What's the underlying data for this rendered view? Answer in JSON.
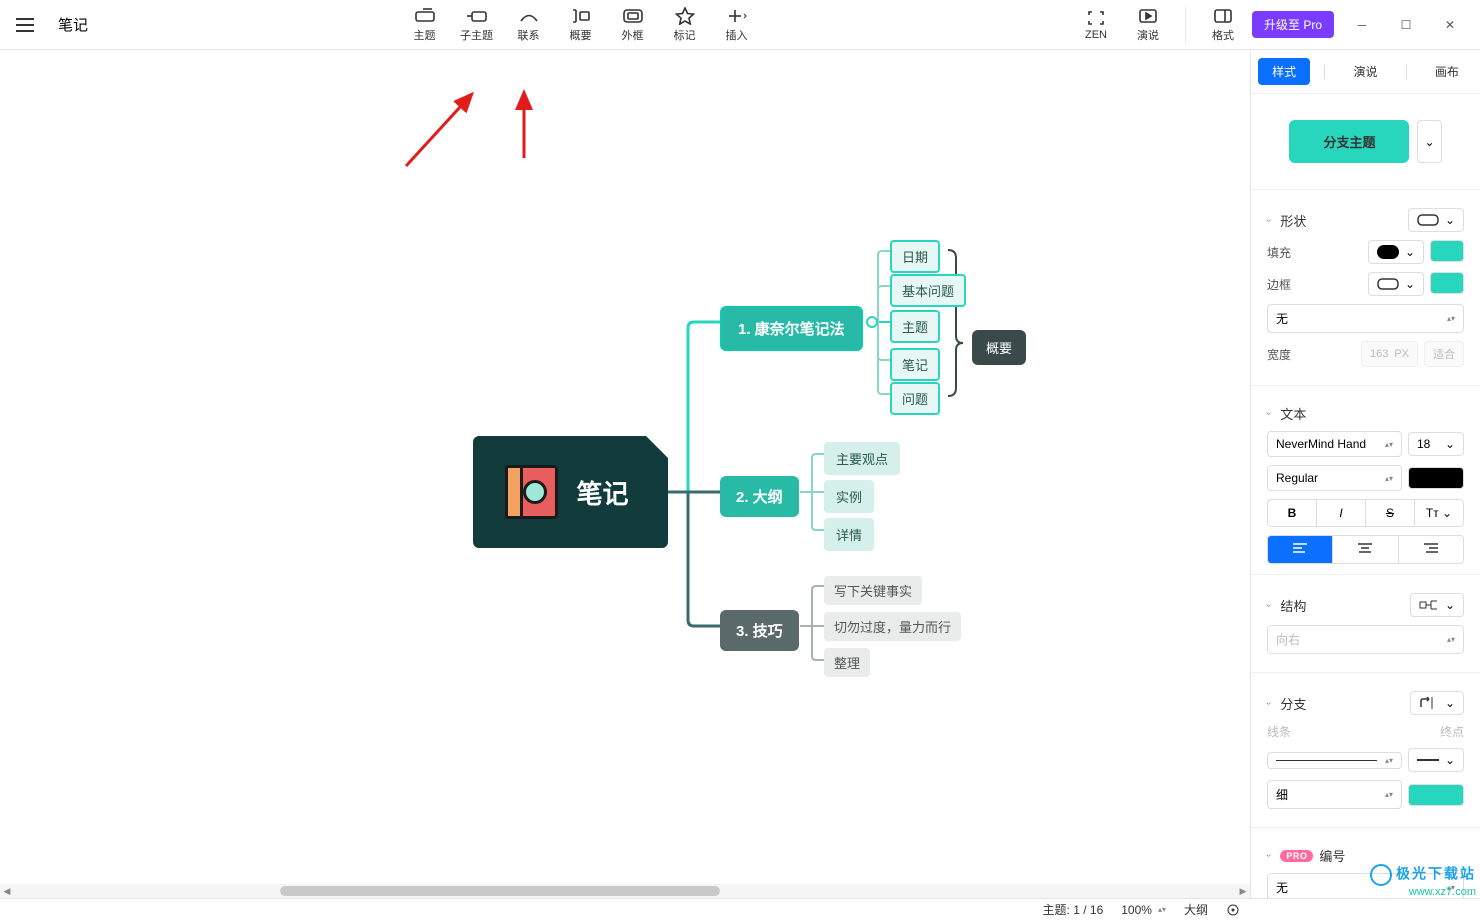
{
  "header": {
    "doc_title": "笔记",
    "toolbar": [
      {
        "id": "topic",
        "label": "主题"
      },
      {
        "id": "subtopic",
        "label": "子主题"
      },
      {
        "id": "relation",
        "label": "联系"
      },
      {
        "id": "summary",
        "label": "概要"
      },
      {
        "id": "boundary",
        "label": "外框"
      },
      {
        "id": "marker",
        "label": "标记"
      },
      {
        "id": "insert",
        "label": "插入"
      }
    ],
    "right_tools": [
      {
        "id": "zen",
        "label": "ZEN"
      },
      {
        "id": "present",
        "label": "演说"
      },
      {
        "id": "format",
        "label": "格式"
      }
    ],
    "pro_button": "升级至 Pro"
  },
  "mindmap": {
    "central": "笔记",
    "branches": [
      {
        "title": "1. 康奈尔笔记法",
        "children": [
          "日期",
          "基本问题",
          "主题",
          "笔记",
          "问题"
        ],
        "summary": "概要"
      },
      {
        "title": "2. 大纲",
        "children": [
          "主要观点",
          "实例",
          "详情"
        ]
      },
      {
        "title": "3. 技巧",
        "children": [
          "写下关键事实",
          "切勿过度，量力而行",
          "整理"
        ]
      }
    ]
  },
  "sidepanel": {
    "tabs": [
      "样式",
      "演说",
      "画布"
    ],
    "node_type": "分支主题",
    "shape": {
      "label": "形状"
    },
    "fill": {
      "label": "填充"
    },
    "border": {
      "label": "边框",
      "line_style": "无"
    },
    "width": {
      "label": "宽度",
      "value": "163",
      "unit": "PX",
      "fit": "适合"
    },
    "text": {
      "label": "文本",
      "font": "NeverMind Hand",
      "size": "18",
      "weight": "Regular"
    },
    "structure": {
      "label": "结构",
      "direction": "向右"
    },
    "branch": {
      "label": "分支",
      "line_label": "线条",
      "end_label": "终点",
      "thickness": "细"
    },
    "numbering": {
      "label": "编号",
      "value": "无",
      "pro": "PRO"
    }
  },
  "statusbar": {
    "topics": "主题: 1 / 16",
    "zoom": "100%",
    "view": "大纲"
  },
  "watermark": {
    "line1": "极光下载站",
    "line2": "www.xz7.com"
  }
}
